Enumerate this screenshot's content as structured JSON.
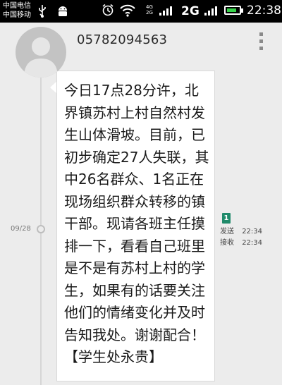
{
  "status_bar": {
    "carrier_1": "中国电信",
    "carrier_2": "中国移动",
    "lte_top": "4G",
    "lte_bottom": "2G",
    "network": "2G",
    "time": "22:38",
    "battery_level": 0.8,
    "icons": [
      "usb-icon",
      "android-icon",
      "alarm-icon",
      "wifi-icon",
      "signal-icon",
      "battery-icon"
    ]
  },
  "header": {
    "sender": "05782094563",
    "menu_icon": "overflow-menu-icon"
  },
  "message": {
    "date": "09/28",
    "body": "今日17点28分许，北界镇苏村上村自然村发生山体滑坡。目前，已初步确定27人失联，其中26名群众、1名正在现场组织群众转移的镇干部。现请各班主任摸排一下，看看自己班里是不是有苏村上村的学生，如果有的话要关注他们的情绪变化并及时告知我处。谢谢配合！【学生处永贵】",
    "sim_slot": "1",
    "sent_label": "发送",
    "sent_time": "22:34",
    "received_label": "接收",
    "received_time": "22:34"
  },
  "colors": {
    "status_bar_bg": "#000000",
    "page_bg": "#ececec",
    "bubble_bg": "#ffffff",
    "sim_badge": "#1f8a6a",
    "battery": "#37d34a"
  }
}
